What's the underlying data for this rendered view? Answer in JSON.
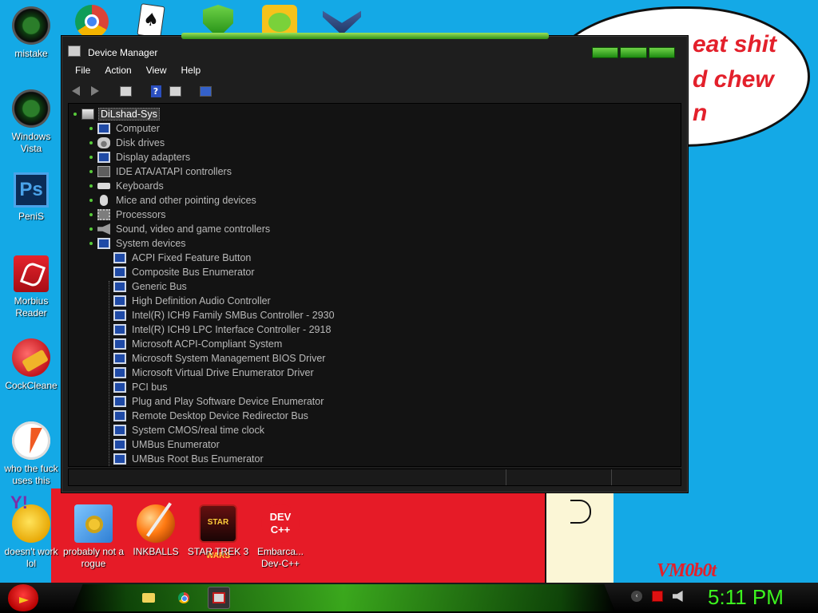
{
  "desktop": {
    "left_icons": [
      {
        "label": "mistake",
        "icon": "green-ball-icon"
      },
      {
        "label": "Windows Vista",
        "icon": "green-ball-icon"
      },
      {
        "label": "PeniS",
        "icon": "photoshop-icon"
      },
      {
        "label": "Morbius Reader",
        "icon": "pdf-reader-icon"
      },
      {
        "label": "CockCleane",
        "icon": "ccleaner-icon"
      },
      {
        "label": "who the fuck uses this",
        "icon": "lightning-icon"
      },
      {
        "label": "doesn't work lol",
        "icon": "yahoo-messenger-icon"
      }
    ],
    "bottom_icons": [
      {
        "label": "probably not a rogue",
        "icon": "gear-setup-icon"
      },
      {
        "label": "INKBALLS",
        "icon": "inkball-icon"
      },
      {
        "label": "STAR TREK 3",
        "icon": "star-trek-icon"
      },
      {
        "label": "Embarca... Dev-C++",
        "icon": "dev-cpp-icon",
        "icon_text": "DEV C++"
      }
    ],
    "top_icons": [
      "chrome-icon",
      "solitaire-icon",
      "security-shield-icon",
      "game-pig-icon",
      "game-logo-icon"
    ],
    "wallpaper": {
      "bubble_lines": [
        "eat shit",
        "d chew",
        "n"
      ],
      "signature": "VM0b0t",
      "colors": {
        "sky": "#14a9e6",
        "red": "#e61b27",
        "text_red": "#e3202b"
      }
    }
  },
  "window": {
    "title": "Device Manager",
    "menu": [
      "File",
      "Action",
      "View",
      "Help"
    ],
    "toolbar": [
      "back-arrow-icon",
      "forward-arrow-icon",
      "properties-icon",
      "help-icon",
      "show-hide-console-tree-icon",
      "monitor-scan-icon"
    ],
    "tree": {
      "root": "DiLshad-Sys",
      "categories": [
        {
          "label": "Computer",
          "icon": "computer-icon"
        },
        {
          "label": "Disk drives",
          "icon": "disk-drive-icon"
        },
        {
          "label": "Display adapters",
          "icon": "display-adapter-icon"
        },
        {
          "label": "IDE ATA/ATAPI controllers",
          "icon": "ide-controller-icon"
        },
        {
          "label": "Keyboards",
          "icon": "keyboard-icon"
        },
        {
          "label": "Mice and other pointing devices",
          "icon": "mouse-icon"
        },
        {
          "label": "Processors",
          "icon": "processor-icon"
        },
        {
          "label": "Sound, video and game controllers",
          "icon": "speaker-icon"
        },
        {
          "label": "System devices",
          "icon": "system-devices-icon"
        }
      ],
      "system_devices": [
        "ACPI Fixed Feature Button",
        "Composite Bus Enumerator",
        "Generic Bus",
        "High Definition Audio Controller",
        "Intel(R) ICH9 Family SMBus Controller - 2930",
        "Intel(R) ICH9 LPC Interface Controller - 2918",
        "Microsoft ACPI-Compliant System",
        "Microsoft System Management BIOS Driver",
        "Microsoft Virtual Drive Enumerator Driver",
        "PCI bus",
        "Plug and Play Software Device Enumerator",
        "Remote Desktop Device Redirector Bus",
        "System CMOS/real time clock",
        "UMBus Enumerator",
        "UMBus Root Bus Enumerator"
      ]
    },
    "colors": {
      "accent": "#3fb81e",
      "background": "#1e1e1e",
      "text": "#b9b9b9"
    }
  },
  "taskbar": {
    "start_icon": "angry-bird-icon",
    "pinned": [
      "folder-icon",
      "chrome-icon",
      "device-manager-icon"
    ],
    "tray": [
      "show-hidden-icons-icon",
      "action-center-flag-icon",
      "volume-icon"
    ],
    "clock": "5:11 PM",
    "clock_color": "#3cf41e"
  }
}
